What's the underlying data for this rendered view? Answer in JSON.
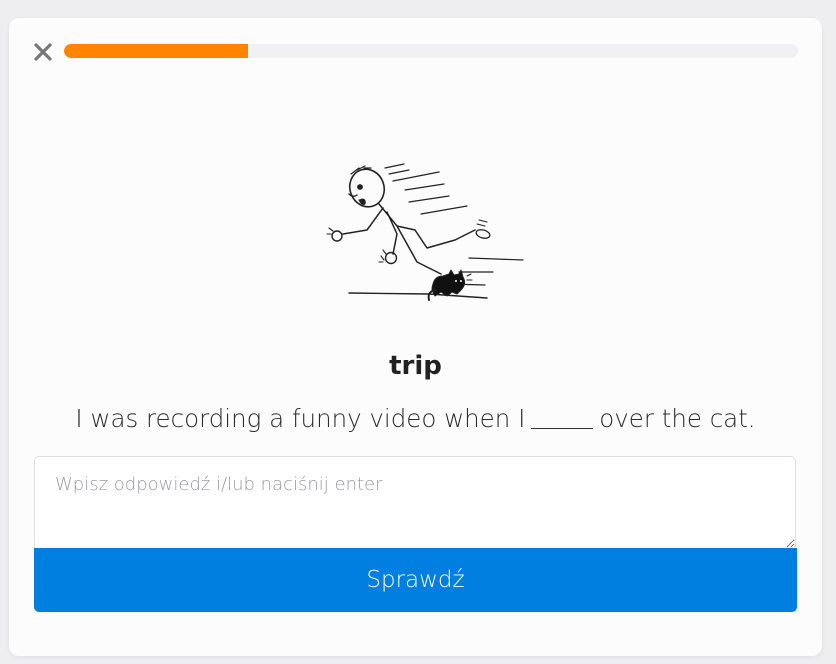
{
  "header": {
    "close_icon": "close-icon",
    "progress": 0.25,
    "progress_color": "#ff8500"
  },
  "illustration": {
    "icon": "stick-figure-tripping-over-cat"
  },
  "exercise": {
    "word": "trip",
    "sentence_before": "I was recording a funny video when I",
    "sentence_after": "over the cat."
  },
  "answer": {
    "value": "",
    "placeholder": "Wpisz odpowiedź i/lub naciśnij enter"
  },
  "submit": {
    "label": "Sprawdź",
    "color": "#007fe0"
  }
}
